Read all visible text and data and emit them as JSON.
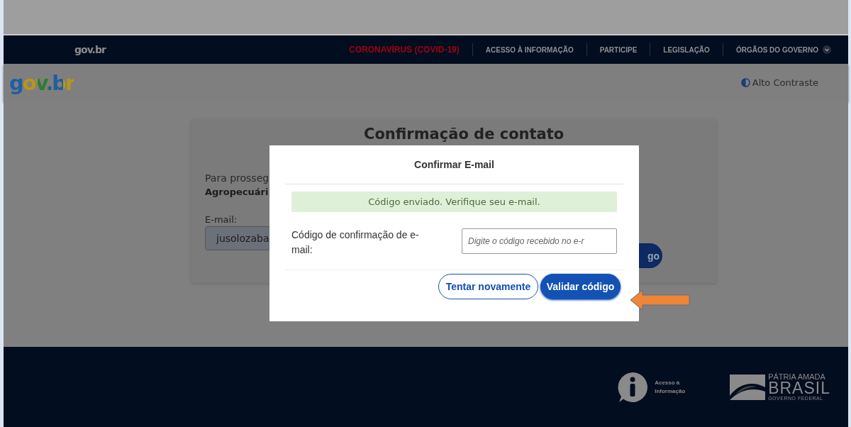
{
  "top_bar": {
    "logo": "gov.br",
    "links": [
      {
        "label": "CORONAVÍRUS (COVID-19)",
        "kind": "alert"
      },
      {
        "label": "ACESSO À INFORMAÇÃO",
        "kind": "normal"
      },
      {
        "label": "PARTICIPE",
        "kind": "normal"
      },
      {
        "label": "LEGISLAÇÃO",
        "kind": "normal"
      },
      {
        "label": "ÓRGÃOS DO GOVERNO",
        "kind": "dropdown"
      }
    ]
  },
  "header": {
    "logo": "gov.br",
    "contrast_toggle": "Alto Contraste"
  },
  "card": {
    "title": "Confirmação de contato",
    "intro": "Para prosseg",
    "intro_bold": "Agropecuári",
    "email_label": "E-mail:",
    "email_value": "jusolozaba",
    "button": "go"
  },
  "modal": {
    "title": "Confirmar E-mail",
    "alert": "Código enviado. Verifique seu e-mail.",
    "field_label": "Código de confirmação de e-mail:",
    "field_placeholder": "Digite o código recebido no e-r",
    "buttons": [
      {
        "label": "Tentar novamente",
        "kind": "secondary"
      },
      {
        "label": "Validar código",
        "kind": "primary"
      }
    ]
  },
  "footer": {
    "info_label": "Acesso à Informação",
    "brand_line_1": "PÁTRIA AMADA",
    "brand_line_2": "BRASIL",
    "brand_line_3": "GOVERNO FEDERAL"
  }
}
